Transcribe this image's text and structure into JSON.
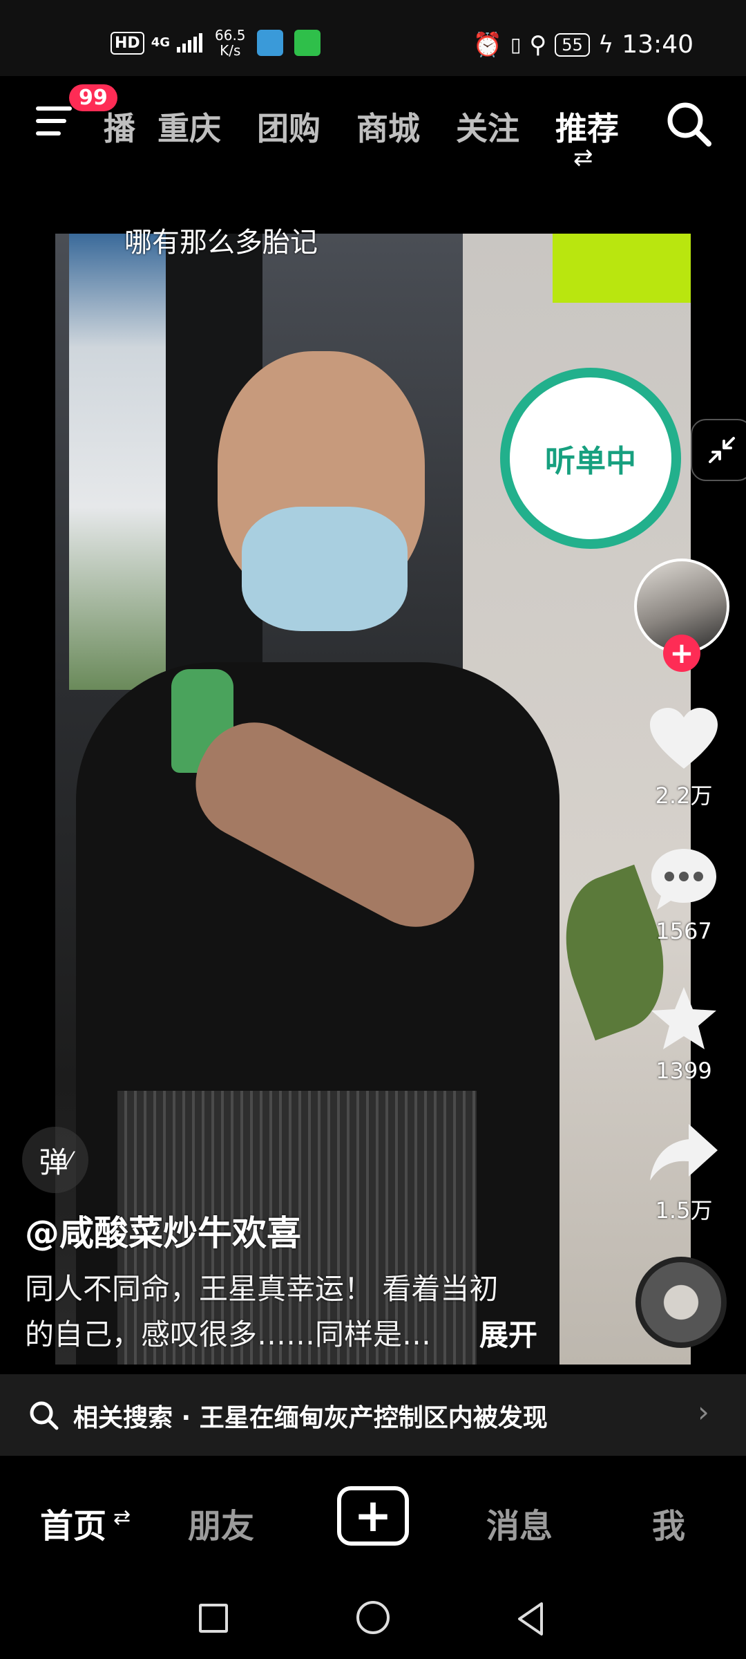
{
  "status_bar": {
    "hd": "HD",
    "network": "4G",
    "speed_value": "66.5",
    "speed_unit": "K/s",
    "battery": "55",
    "time": "13:40",
    "icons": [
      "alarm-icon",
      "vibrate-icon",
      "location-icon",
      "charging-icon"
    ]
  },
  "top_nav": {
    "menu_badge": "99",
    "tabs": [
      "播",
      "重庆",
      "团购",
      "商城",
      "关注",
      "推荐"
    ],
    "active_tab": "推荐",
    "search_icon": "search-icon"
  },
  "video": {
    "caption_overlay": "哪有那么多胎记"
  },
  "listen_badge": {
    "label": "听单中",
    "color": "#22b08c"
  },
  "right_rail": {
    "likes": "2.2万",
    "comments": "1567",
    "favorites": "1399",
    "shares": "1.5万"
  },
  "danmaku_label": "弹",
  "post": {
    "author": "@咸酸菜炒牛欢喜",
    "description_line1": "同人不同命，王星真幸运！ 看着当初",
    "description_line2": "的自己，感叹很多……同样是…",
    "expand_label": "展开"
  },
  "related_search": {
    "text": "相关搜索 · 王星在缅甸灰产控制区内被发现"
  },
  "bottom_nav": {
    "tabs": [
      "首页",
      "朋友",
      "消息",
      "我"
    ],
    "active_tab": "首页"
  },
  "colors": {
    "accent_red": "#fe2c55",
    "listen_green": "#22b08c"
  }
}
